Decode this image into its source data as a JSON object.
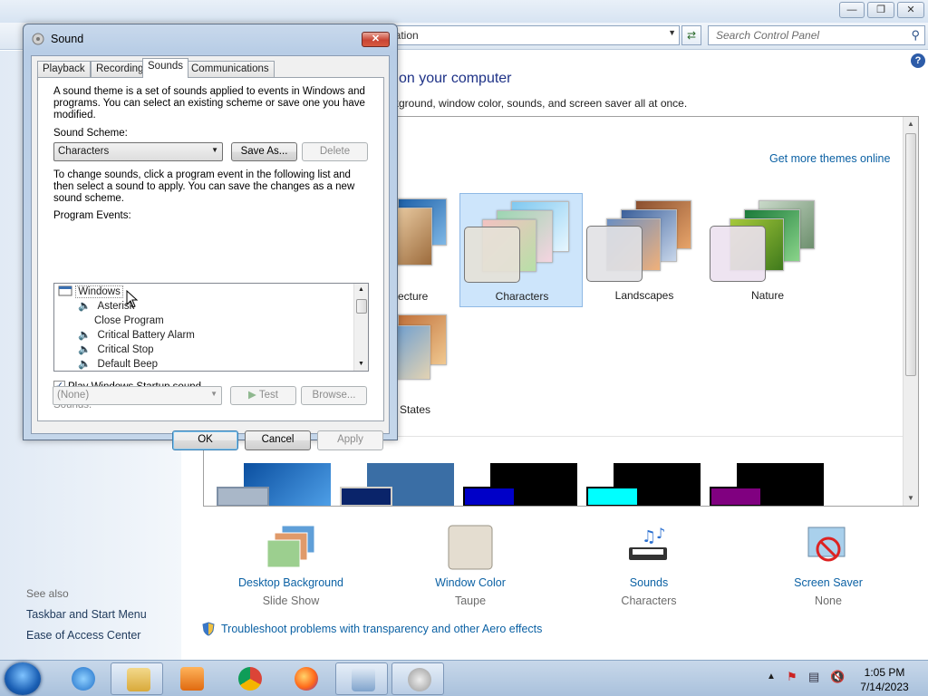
{
  "control_panel": {
    "address": "ization",
    "search_placeholder": "Search Control Panel",
    "heading": "on your computer",
    "description": "kground, window color, sounds, and screen saver all at once.",
    "get_more_link": "Get more themes online",
    "themes": [
      {
        "label": "Characters",
        "selected": true
      },
      {
        "label": "Landscapes",
        "selected": false
      },
      {
        "label": "Nature",
        "selected": false
      }
    ],
    "partial_theme_labels": [
      "ecture",
      "States"
    ],
    "bottom_items": [
      {
        "label": "Desktop Background",
        "value": "Slide Show",
        "icon": "desktop-background-icon"
      },
      {
        "label": "Window Color",
        "value": "Taupe",
        "icon": "window-color-icon"
      },
      {
        "label": "Sounds",
        "value": "Characters",
        "icon": "sounds-icon"
      },
      {
        "label": "Screen Saver",
        "value": "None",
        "icon": "screen-saver-icon"
      }
    ],
    "troubleshoot_link": "Troubleshoot problems with transparency and other Aero effects",
    "see_also": "See also",
    "sidebar_links": [
      "Taskbar and Start Menu",
      "Ease of Access Center"
    ]
  },
  "dialog": {
    "title": "Sound",
    "tabs": [
      {
        "label": "Playback",
        "active": false
      },
      {
        "label": "Recording",
        "active": false
      },
      {
        "label": "Sounds",
        "active": true
      },
      {
        "label": "Communications",
        "active": false
      }
    ],
    "intro_text": "A sound theme is a set of sounds applied to events in Windows and programs.  You can select an existing scheme or save one you have modified.",
    "scheme_label": "Sound Scheme:",
    "scheme_value": "Characters",
    "save_as_button": "Save As...",
    "delete_button": "Delete",
    "change_text": "To change sounds, click a program event in the following list and then select a sound to apply.  You can save the changes as a new sound scheme.",
    "events_label": "Program Events:",
    "events": [
      {
        "label": "Windows",
        "level": 0,
        "has_sound": false
      },
      {
        "label": "Asterisk",
        "level": 1,
        "has_sound": true
      },
      {
        "label": "Close Program",
        "level": 1,
        "has_sound": false
      },
      {
        "label": "Critical Battery Alarm",
        "level": 1,
        "has_sound": true
      },
      {
        "label": "Critical Stop",
        "level": 1,
        "has_sound": true
      },
      {
        "label": "Default Beep",
        "level": 1,
        "has_sound": true
      }
    ],
    "startup_checkbox_label": "Play Windows Startup sound",
    "startup_checked": true,
    "sounds_label": "Sounds:",
    "sounds_value": "(None)",
    "test_button": "Test",
    "browse_button": "Browse...",
    "ok_button": "OK",
    "cancel_button": "Cancel",
    "apply_button": "Apply"
  },
  "taskbar": {
    "clock_time": "1:05 PM",
    "clock_date": "7/14/2023"
  }
}
